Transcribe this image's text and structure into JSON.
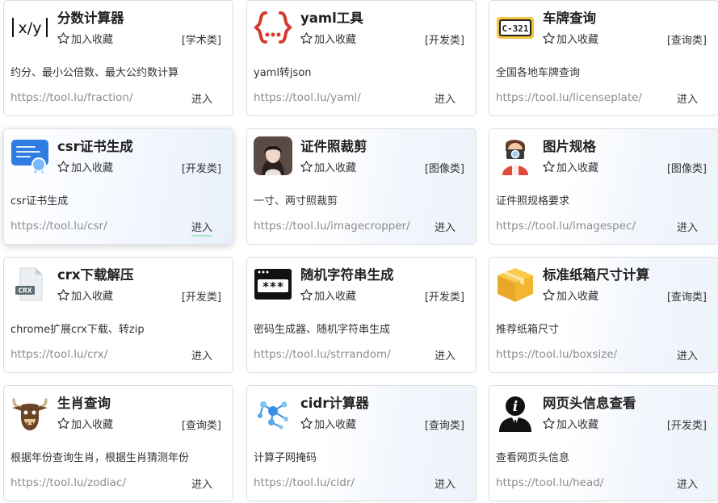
{
  "common": {
    "fav_label": "加入收藏",
    "enter_label": "进入"
  },
  "tools": [
    {
      "title": "分数计算器",
      "category": "[学术类]",
      "desc": "约分、最小公倍数、最大公约数计算",
      "url": "https://tool.lu/fraction/",
      "icon": "fraction-icon"
    },
    {
      "title": "yaml工具",
      "category": "[开发类]",
      "desc": "yaml转json",
      "url": "https://tool.lu/yaml/",
      "icon": "yaml-braces-icon"
    },
    {
      "title": "车牌查询",
      "category": "[查询类]",
      "desc": "全国各地车牌查询",
      "url": "https://tool.lu/licenseplate/",
      "icon": "license-plate-icon",
      "plate_text": "C-321"
    },
    {
      "title": "csr证书生成",
      "category": "[开发类]",
      "desc": "csr证书生成",
      "url": "https://tool.lu/csr/",
      "icon": "certificate-icon"
    },
    {
      "title": "证件照裁剪",
      "category": "[图像类]",
      "desc": "一寸、两寸照裁剪",
      "url": "https://tool.lu/imagecropper/",
      "icon": "portrait-photo-icon"
    },
    {
      "title": "图片规格",
      "category": "[图像类]",
      "desc": "证件照规格要求",
      "url": "https://tool.lu/imagespec/",
      "icon": "photographer-icon"
    },
    {
      "title": "crx下载解压",
      "category": "[开发类]",
      "desc": "chrome扩展crx下载、转zip",
      "url": "https://tool.lu/crx/",
      "icon": "crx-file-icon",
      "file_text": "CRX"
    },
    {
      "title": "随机字符串生成",
      "category": "[开发类]",
      "desc": "密码生成器、随机字符串生成",
      "url": "https://tool.lu/strrandom/",
      "icon": "password-window-icon",
      "pw_text": "***"
    },
    {
      "title": "标准纸箱尺寸计算",
      "category": "[查询类]",
      "desc": "推荐纸箱尺寸",
      "url": "https://tool.lu/boxsize/",
      "icon": "cardboard-box-icon"
    },
    {
      "title": "生肖查询",
      "category": "[查询类]",
      "desc": "根据年份查询生肖，根据生肖猜测年份",
      "url": "https://tool.lu/zodiac/",
      "icon": "ox-head-icon"
    },
    {
      "title": "cidr计算器",
      "category": "[查询类]",
      "desc": "计算子网掩码",
      "url": "https://tool.lu/cidr/",
      "icon": "network-nodes-icon"
    },
    {
      "title": "网页头信息查看",
      "category": "[开发类]",
      "desc": "查看网页头信息",
      "url": "https://tool.lu/head/",
      "icon": "info-person-icon"
    }
  ],
  "colors": {
    "yaml_red": "#d63a2f",
    "cert_blue": "#2f7de1",
    "box_yellow": "#f2b630",
    "plate_yellow": "#f5c542",
    "ox_brown": "#6b4428",
    "network_blue": "#3a8ee6"
  }
}
